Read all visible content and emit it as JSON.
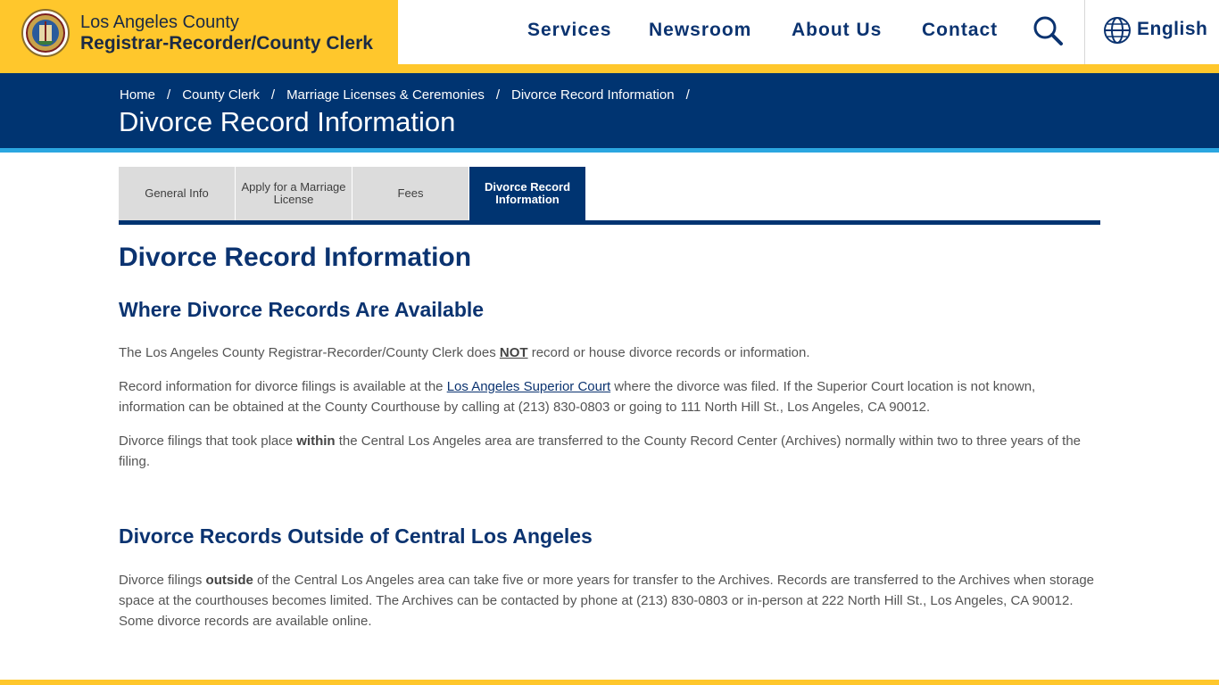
{
  "header": {
    "brand_line1": "Los Angeles County",
    "brand_line2": "Registrar-Recorder/County Clerk",
    "nav": [
      "Services",
      "Newsroom",
      "About Us",
      "Contact"
    ],
    "language": "English",
    "colors": {
      "gold": "#ffc72c",
      "navy": "#003471"
    }
  },
  "banner": {
    "breadcrumb": [
      "Home",
      "County Clerk",
      "Marriage Licenses & Ceremonies",
      "Divorce Record Information"
    ],
    "separator": "/",
    "title": "Divorce Record Information"
  },
  "tabs": [
    {
      "label": "General Info"
    },
    {
      "label": "Apply for a Marriage License"
    },
    {
      "label": "Fees"
    },
    {
      "label": "Divorce Record Information",
      "active": true
    }
  ],
  "content": {
    "title": "Divorce Record Information",
    "section1": {
      "heading": "Where Divorce Records Are Available",
      "p1_before": "The Los Angeles County Registrar-Recorder/County Clerk does ",
      "p1_emph": "NOT",
      "p1_after": " record or house divorce records or information.",
      "p2_before": "Record information for divorce filings is available at the ",
      "p2_link": "Los Angeles Superior Court",
      "p2_after": " where the divorce was filed. If the Superior Court location is not known, information can be obtained at the County Courthouse by calling at (213) 830-0803 or going to 111 North Hill St., Los Angeles, CA 90012.",
      "p3_before": "Divorce filings that took place ",
      "p3_emph": "within",
      "p3_after": " the Central Los Angeles area are transferred to the County Record Center (Archives) normally within two to three years of the filing."
    },
    "section2": {
      "heading": "Divorce Records Outside of Central Los Angeles",
      "p1_before": "Divorce filings ",
      "p1_emph": "outside",
      "p1_after": " of the Central Los Angeles area can take five or more years for transfer to the Archives. Records are transferred to the Archives when storage space at the courthouses becomes limited. The Archives can be contacted by phone at (213) 830-0803 or in-person at 222 North Hill St., Los Angeles, CA 90012. Some divorce records are available online."
    }
  }
}
